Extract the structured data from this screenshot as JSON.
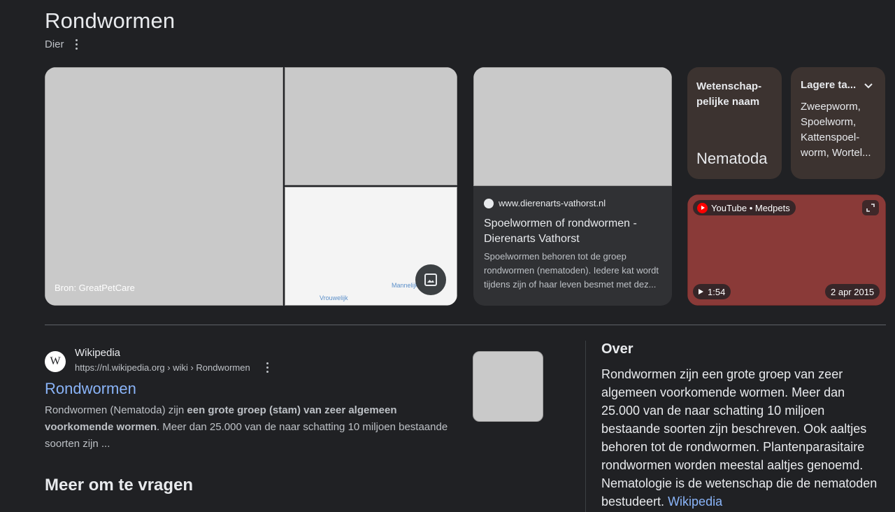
{
  "header": {
    "title": "Rondwormen",
    "subtitle": "Dier"
  },
  "images": {
    "main_caption": "Bron: GreatPetCare",
    "diagram_label_female": "Vrouwelijk",
    "diagram_label_male": "Mannelijk"
  },
  "article_card": {
    "source": "www.dierenarts-vathorst.nl",
    "title": "Spoelwormen of rondwormen - Dierenarts Vathorst",
    "snippet": "Spoelwormen behoren tot de groep rondwormen (nematoden). Iedere kat wordt tijdens zijn of haar leven besmet met dez..."
  },
  "attributes": {
    "scientific_name_label": "Wetenschap-pelijke naam",
    "scientific_name_value": "Nematoda",
    "lower_taxa_label": "Lagere ta...",
    "lower_taxa_value": "Zweepworm, Spoelworm, Kattenspoel-worm, Wortel..."
  },
  "video_card": {
    "source": "YouTube • Medpets",
    "duration": "1:54",
    "date": "2 apr 2015"
  },
  "wikipedia_result": {
    "site_name": "Wikipedia",
    "url": "https://nl.wikipedia.org › wiki › Rondwormen",
    "title": "Rondwormen",
    "snippet_start": "Rondwormen (Nematoda) zijn ",
    "snippet_bold": "een grote groep (stam) van zeer algemeen voorkomende wormen",
    "snippet_end": ". Meer dan 25.000 van de naar schatting 10 miljoen bestaande soorten zijn ..."
  },
  "people_also_ask": {
    "heading": "Meer om te vragen"
  },
  "over": {
    "heading": "Over",
    "text": "Rondwormen zijn een grote groep van zeer algemeen voorkomende wormen. Meer dan 25.000 van de naar schatting 10 miljoen bestaande soorten zijn beschreven. Ook aaltjes behoren tot de rondwormen. Plantenparasitaire rondwormen worden meestal aaltjes genoemd. Nematologie is de wetenschap die de nematoden bestudeert. ",
    "link": "Wikipedia"
  }
}
